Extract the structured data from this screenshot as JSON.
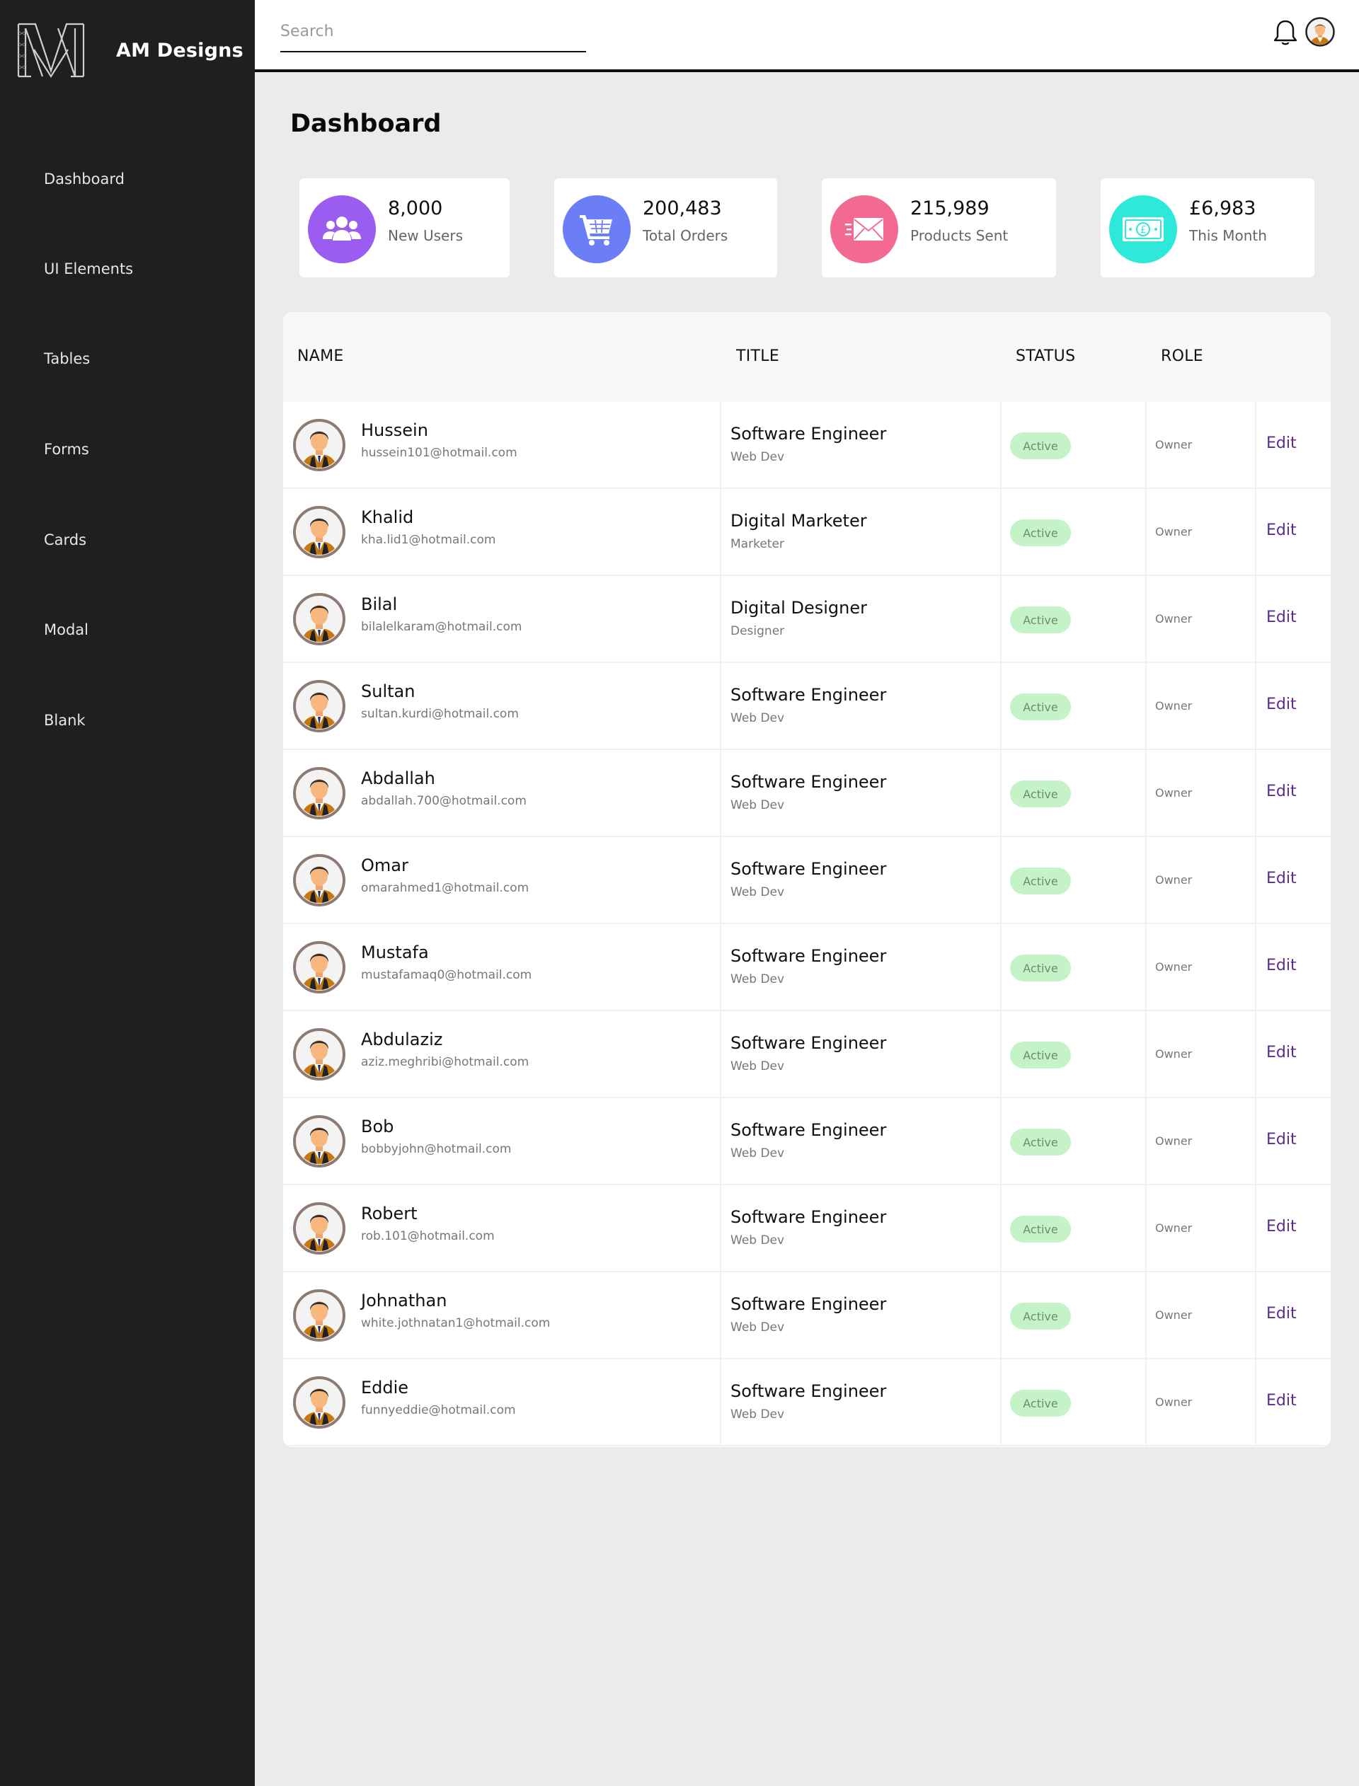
{
  "brand": {
    "name": "AM Designs"
  },
  "sidebar": {
    "items": [
      {
        "label": "Dashboard"
      },
      {
        "label": "UI Elements"
      },
      {
        "label": "Tables"
      },
      {
        "label": "Forms"
      },
      {
        "label": "Cards"
      },
      {
        "label": "Modal"
      },
      {
        "label": "Blank"
      }
    ]
  },
  "header": {
    "search_placeholder": "Search",
    "icons": [
      "bell-icon",
      "user-avatar"
    ]
  },
  "page": {
    "title": "Dashboard"
  },
  "stats": [
    {
      "value": "8,000",
      "label": "New Users",
      "icon": "users-icon",
      "color": "#9b5cf0"
    },
    {
      "value": "200,483",
      "label": "Total Orders",
      "icon": "cart-icon",
      "color": "#6b7ef5"
    },
    {
      "value": "215,989",
      "label": "Products Sent",
      "icon": "mail-icon",
      "color": "#f26a92"
    },
    {
      "value": "£6,983",
      "label": "This Month",
      "icon": "money-icon",
      "color": "#2ee8da"
    }
  ],
  "table": {
    "headers": {
      "name": "NAME",
      "title": "TITLE",
      "status": "STATUS",
      "role": "ROLE"
    },
    "rows": [
      {
        "name": "Hussein",
        "email": "hussein101@hotmail.com",
        "title": "Software Engineer",
        "subtitle": "Web Dev",
        "status": "Active",
        "role": "Owner",
        "action": "Edit"
      },
      {
        "name": "Khalid",
        "email": "kha.lid1@hotmail.com",
        "title": "Digital Marketer",
        "subtitle": "Marketer",
        "status": "Active",
        "role": "Owner",
        "action": "Edit"
      },
      {
        "name": "Bilal",
        "email": "bilalelkaram@hotmail.com",
        "title": "Digital Designer",
        "subtitle": "Designer",
        "status": "Active",
        "role": "Owner",
        "action": "Edit"
      },
      {
        "name": "Sultan",
        "email": "sultan.kurdi@hotmail.com",
        "title": "Software Engineer",
        "subtitle": "Web Dev",
        "status": "Active",
        "role": "Owner",
        "action": "Edit"
      },
      {
        "name": "Abdallah",
        "email": "abdallah.700@hotmail.com",
        "title": "Software Engineer",
        "subtitle": "Web Dev",
        "status": "Active",
        "role": "Owner",
        "action": "Edit"
      },
      {
        "name": "Omar",
        "email": "omarahmed1@hotmail.com",
        "title": "Software Engineer",
        "subtitle": "Web Dev",
        "status": "Active",
        "role": "Owner",
        "action": "Edit"
      },
      {
        "name": "Mustafa",
        "email": "mustafamaq0@hotmail.com",
        "title": "Software Engineer",
        "subtitle": "Web Dev",
        "status": "Active",
        "role": "Owner",
        "action": "Edit"
      },
      {
        "name": "Abdulaziz",
        "email": "aziz.meghribi@hotmail.com",
        "title": "Software Engineer",
        "subtitle": "Web Dev",
        "status": "Active",
        "role": "Owner",
        "action": "Edit"
      },
      {
        "name": "Bob",
        "email": "bobbyjohn@hotmail.com",
        "title": "Software Engineer",
        "subtitle": "Web Dev",
        "status": "Active",
        "role": "Owner",
        "action": "Edit"
      },
      {
        "name": "Robert",
        "email": "rob.101@hotmail.com",
        "title": "Software Engineer",
        "subtitle": "Web Dev",
        "status": "Active",
        "role": "Owner",
        "action": "Edit"
      },
      {
        "name": "Johnathan",
        "email": "white.jothnatan1@hotmail.com",
        "title": "Software Engineer",
        "subtitle": "Web Dev",
        "status": "Active",
        "role": "Owner",
        "action": "Edit"
      },
      {
        "name": "Eddie",
        "email": "funnyeddie@hotmail.com",
        "title": "Software Engineer",
        "subtitle": "Web Dev",
        "status": "Active",
        "role": "Owner",
        "action": "Edit"
      }
    ]
  },
  "colors": {
    "sidebar_bg": "#1f1f1f",
    "page_bg": "#ebebeb",
    "badge_bg": "#c5f3c8",
    "edit_link": "#5b2b8f"
  }
}
